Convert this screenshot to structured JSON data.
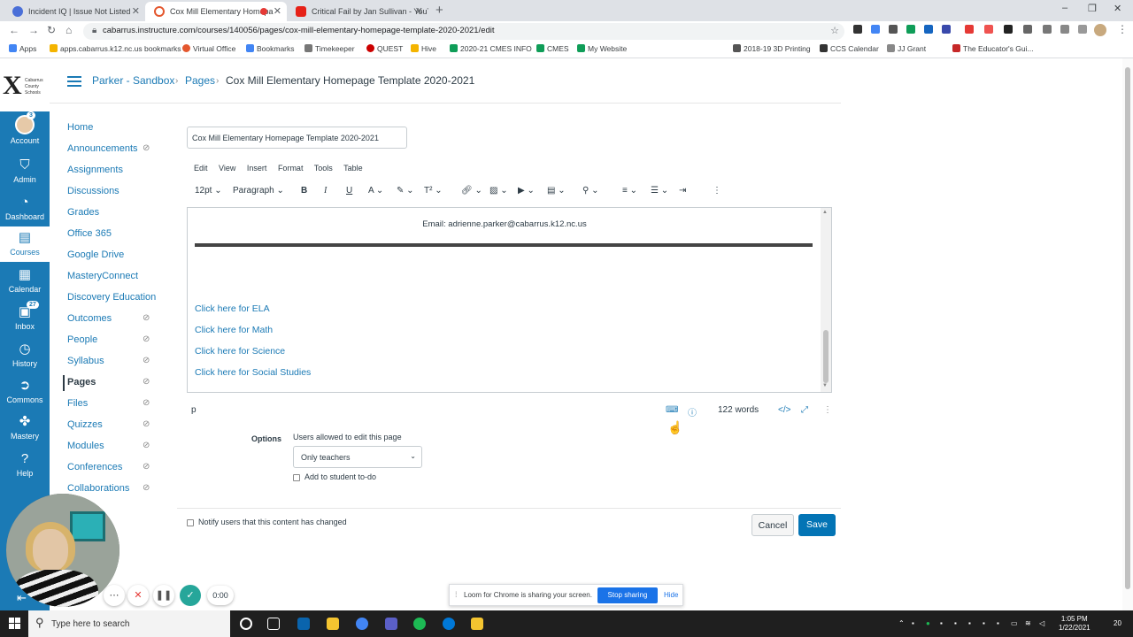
{
  "browser": {
    "tabs": [
      {
        "title": "Incident IQ | Issue Not Listed"
      },
      {
        "title": "Cox Mill Elementary Homepa"
      },
      {
        "title": "Critical Fail by Jan Sullivan - YouT"
      }
    ],
    "url": "cabarrus.instructure.com/courses/140056/pages/cox-mill-elementary-homepage-template-2020-2021/edit",
    "bookmarks": [
      "Apps",
      "apps.cabarrus.k12.nc.us bookmarks",
      "Virtual Office",
      "Bookmarks",
      "Timekeeper",
      "QUEST",
      "Hive",
      "2020-21 CMES INFO",
      "CMES",
      "My Website",
      "2018-19 3D Printing",
      "CCS Calendar",
      "JJ Grant",
      "The Educator's Gui..."
    ]
  },
  "global_nav": {
    "logo_text": "Cabarrus County Schools",
    "items": [
      {
        "label": "Account",
        "icon": "avatar",
        "badge": "3"
      },
      {
        "label": "Admin",
        "icon": "shield-icon"
      },
      {
        "label": "Dashboard",
        "icon": "dashboard-icon"
      },
      {
        "label": "Courses",
        "icon": "book-icon"
      },
      {
        "label": "Calendar",
        "icon": "calendar-icon"
      },
      {
        "label": "Inbox",
        "icon": "inbox-icon",
        "badge": "27"
      },
      {
        "label": "History",
        "icon": "clock-icon"
      },
      {
        "label": "Commons",
        "icon": "commons-icon"
      },
      {
        "label": "Mastery",
        "icon": "mastery-icon"
      },
      {
        "label": "Help",
        "icon": "help-icon"
      }
    ]
  },
  "breadcrumb": {
    "course": "Parker - Sandbox",
    "section": "Pages",
    "current": "Cox Mill Elementary Homepage Template 2020-2021"
  },
  "course_nav": [
    {
      "label": "Home",
      "hidden": false
    },
    {
      "label": "Announcements",
      "hidden": true
    },
    {
      "label": "Assignments",
      "hidden": false
    },
    {
      "label": "Discussions",
      "hidden": false
    },
    {
      "label": "Grades",
      "hidden": false
    },
    {
      "label": "Office 365",
      "hidden": false
    },
    {
      "label": "Google Drive",
      "hidden": false
    },
    {
      "label": "MasteryConnect",
      "hidden": false
    },
    {
      "label": "Discovery Education",
      "hidden": false
    },
    {
      "label": "Outcomes",
      "hidden": true
    },
    {
      "label": "People",
      "hidden": true
    },
    {
      "label": "Syllabus",
      "hidden": true
    },
    {
      "label": "Pages",
      "hidden": true,
      "active": true
    },
    {
      "label": "Files",
      "hidden": true
    },
    {
      "label": "Quizzes",
      "hidden": true
    },
    {
      "label": "Modules",
      "hidden": true
    },
    {
      "label": "Conferences",
      "hidden": true
    },
    {
      "label": "Collaborations",
      "hidden": true
    }
  ],
  "editor": {
    "title_value": "Cox Mill Elementary  Homepage Template 2020-2021",
    "menu": [
      "Edit",
      "View",
      "Insert",
      "Format",
      "Tools",
      "Table"
    ],
    "font_size": "12pt",
    "block_format": "Paragraph",
    "content": {
      "email": "Email: adrienne.parker@cabarrus.k12.nc.us",
      "links": [
        "Click here for ELA",
        "Click here for Math",
        "Click here for Science",
        "Click here for Social Studies"
      ]
    },
    "status_path": "p",
    "word_count": "122 words"
  },
  "options": {
    "label": "Options",
    "edit_label": "Users allowed to edit this page",
    "edit_value": "Only teachers",
    "todo_label": "Add to student to-do",
    "notify_label": "Notify users that this content has changed"
  },
  "buttons": {
    "cancel": "Cancel",
    "save": "Save"
  },
  "recorder": {
    "time": "0:00"
  },
  "loom": {
    "message": "Loom for Chrome is sharing your screen.",
    "stop": "Stop sharing",
    "hide": "Hide"
  },
  "taskbar": {
    "search_placeholder": "Type here to search",
    "time": "1:05 PM",
    "date": "1/22/2021",
    "notif_count": "20"
  }
}
